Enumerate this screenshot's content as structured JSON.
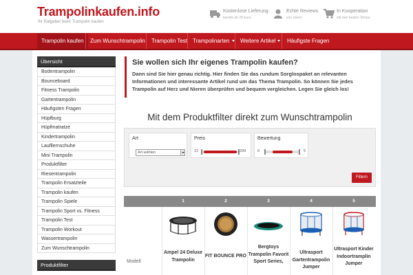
{
  "header": {
    "logo": "Trampolinkaufen.info",
    "tagline": "Ihr Ratgeber beim Trampolin kaufen",
    "features": [
      {
        "icon": "truck-icon",
        "title": "Kostenlose Lieferung",
        "sub": "bereits ab 29 Euro"
      },
      {
        "icon": "user-icon",
        "title": "Echte Reviews",
        "sub": "von Usern"
      },
      {
        "icon": "cart-icon",
        "title": "In Kooperation",
        "sub": "mit den besten Shops"
      }
    ]
  },
  "nav": {
    "items": [
      {
        "label": "Trampolin kaufen",
        "active": true
      },
      {
        "label": "Zum Wunschtrampolin"
      },
      {
        "label": "Trampolin Test"
      },
      {
        "label": "Trampolinarten",
        "dropdown": true
      },
      {
        "label": "Weitere Artikel",
        "dropdown": true
      },
      {
        "label": "Häufigste Fragen"
      }
    ]
  },
  "sidebar": {
    "title": "Übersicht",
    "items": [
      "Bodentrampolin",
      "Bounceboard",
      "Fitness Trampolin",
      "Gartentrampolin",
      "Häufigsten Fragen",
      "Hüpfburg",
      "Hüpfmatratze",
      "Kindertrampolin",
      "Laufllernschuhe",
      "Mini Trampolin",
      "Produktfilter",
      "Riesentrampolin",
      "Trampolin Ersatzteile",
      "Trampolin kaufen",
      "Trampolin Spiele",
      "Trampolin Sport vs. Fitness",
      "Trampolin Test",
      "Trampolin Workout",
      "Wassertrampolin",
      "Zum Wunschtrampolin"
    ],
    "title2": "Produktfilter"
  },
  "intro": {
    "title": "Sie wollen sich Ihr eigenes Trampolin kaufen?",
    "text": "Dann sind Sie hier genau richtig. Hier finden Sie das rundum Sorglospaket an relevanten Informationen und interessante Artikel rund um das Thema Trampolin. So können Sie jedes Trampolin auf Herz und Nieren überprüfen und bequem vergleichen. Legen Sie gleich los!"
  },
  "filter": {
    "title": "Mit dem Produktfilter direkt zum Wunschtrampolin",
    "art": {
      "label": "Art",
      "value": "Art wählen"
    },
    "preis": {
      "label": "Preis",
      "min": "12",
      "max": "299",
      "fill": 0.85
    },
    "bewertung": {
      "label": "Bewertung",
      "min": "0",
      "max": "5",
      "fill": 0.55
    },
    "button": "Filtern"
  },
  "products": {
    "row_label": "Modell",
    "items": [
      {
        "num": "1",
        "name": "Ampel 24 Deluxe Trampolin"
      },
      {
        "num": "2",
        "name": "FIT BOUNCE PRO"
      },
      {
        "num": "3",
        "name": "Bergtoys Trampolin Favorit Sport Series,"
      },
      {
        "num": "4",
        "name": "Ultrasport Gartentrampolin Jumper"
      },
      {
        "num": "5",
        "name": "Ultrasport Kinder Indoortramplin Jumper"
      }
    ]
  },
  "colors": {
    "brand": "#c0181f",
    "nav_dark": "#8d0f14",
    "sidebar_head": "#3a3a3a"
  }
}
